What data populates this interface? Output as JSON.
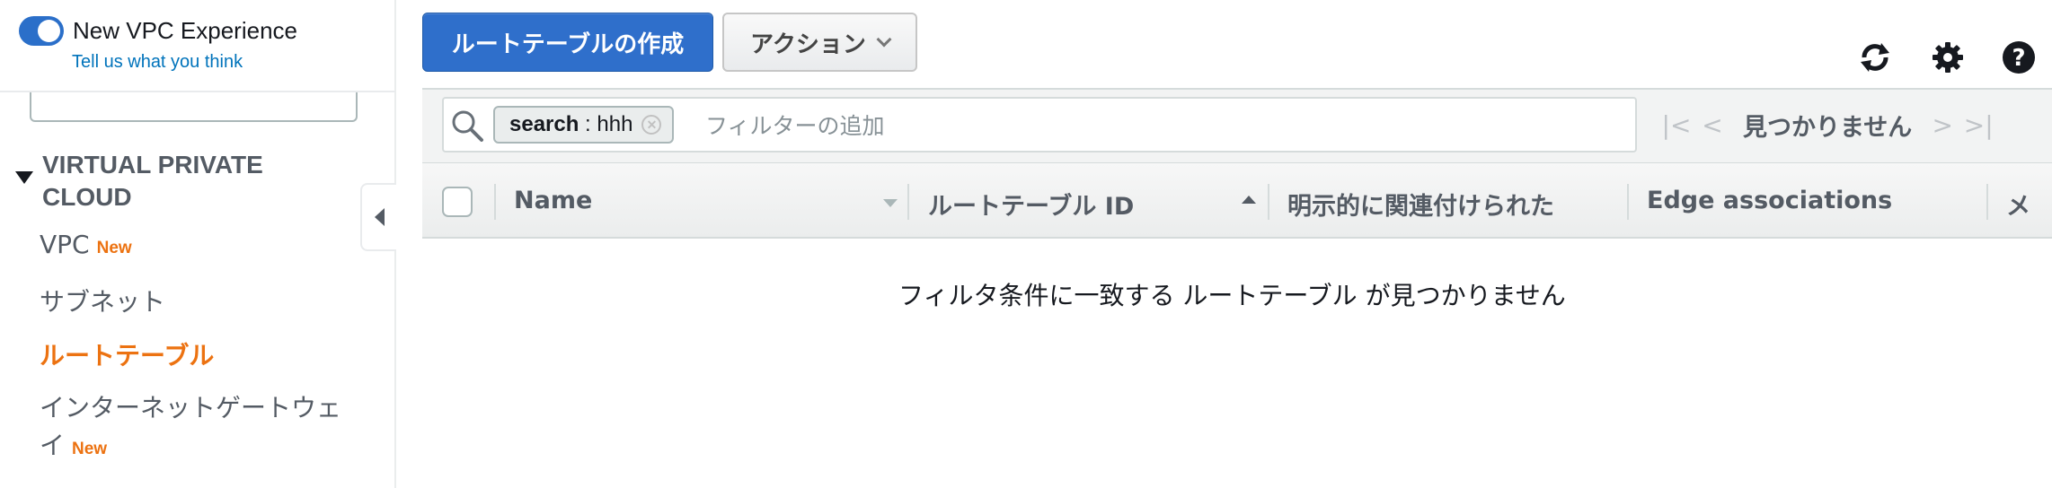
{
  "sidebar": {
    "toggle_label": "New VPC Experience",
    "toggle_on": true,
    "feedback_link": "Tell us what you think",
    "section_title": "VIRTUAL PRIVATE CLOUD",
    "items": [
      {
        "label": "VPC",
        "badge": "New"
      },
      {
        "label": "サブネット",
        "badge": ""
      },
      {
        "label": "ルートテーブル",
        "badge": "",
        "active": true
      },
      {
        "label": "インターネットゲートウェイ",
        "badge": "New"
      }
    ]
  },
  "toolbar": {
    "create_label": "ルートテーブルの作成",
    "actions_label": "アクション"
  },
  "icons": {
    "refresh": "refresh-icon",
    "settings": "gear-icon",
    "help": "help-icon"
  },
  "filter": {
    "token_key": "search",
    "token_value": "hhh",
    "placeholder": "フィルターの追加"
  },
  "pager": {
    "status": "見つかりません"
  },
  "table": {
    "columns": [
      "Name",
      "ルートテーブル ID",
      "明示的に関連付けられた",
      "Edge associations",
      "メ"
    ],
    "empty_message": "フィルタ条件に一致する ルートテーブル が見つかりません"
  },
  "colors": {
    "accent_blue": "#2f6fcb",
    "active_orange": "#ec7211",
    "link_blue": "#0073bb"
  }
}
